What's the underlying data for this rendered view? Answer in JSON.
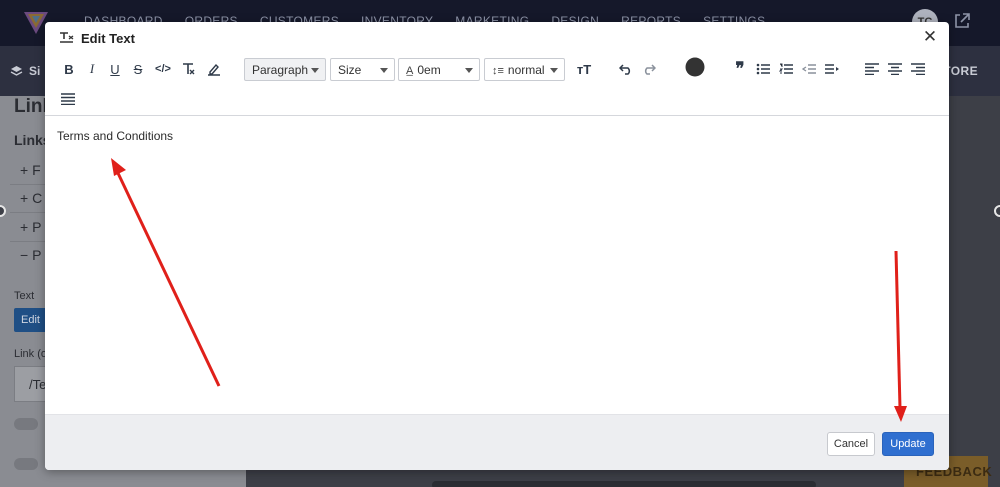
{
  "app": {
    "nav": [
      "DASHBOARD",
      "ORDERS",
      "CUSTOMERS",
      "INVENTORY",
      "MARKETING",
      "DESIGN",
      "REPORTS",
      "SETTINGS"
    ],
    "user_initials": "TC",
    "site_label": "Si",
    "store_label": "STORE",
    "feedback_label": "FEEDBACK"
  },
  "left_panel": {
    "title": "Link",
    "links_heading": "Links",
    "items": [
      "+ F",
      "+ C",
      "+ P",
      "− P"
    ],
    "text_label": "Text",
    "edit_button": "Edit",
    "link_label": "Link (o",
    "link_value": "/Te"
  },
  "modal": {
    "title": "Edit Text",
    "title_icon": "text-format-icon",
    "close_icon": "close-icon",
    "toolbar": {
      "block_format": "Paragraph",
      "size": "Size",
      "letter_spacing": "0em",
      "line_height": "normal",
      "text_color": "#333333"
    },
    "content": "Terms and Conditions",
    "cancel_label": "Cancel",
    "update_label": "Update"
  },
  "colors": {
    "primary": "#2f6fd0",
    "annotation_arrow": "#e0201a"
  }
}
